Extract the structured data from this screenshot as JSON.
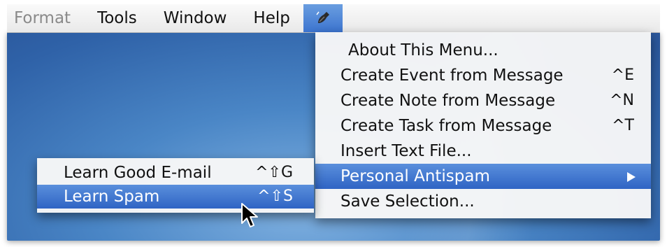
{
  "menubar": {
    "items": [
      "Format",
      "Tools",
      "Window",
      "Help"
    ],
    "script_icon": "script-menu-icon"
  },
  "main_menu": {
    "items": [
      {
        "label": "About This Menu...",
        "shortcut": ""
      },
      {
        "label": "Create Event from Message",
        "shortcut": "^E"
      },
      {
        "label": "Create Note from Message",
        "shortcut": "^N"
      },
      {
        "label": "Create Task from Message",
        "shortcut": "^T"
      },
      {
        "label": "Insert Text File...",
        "shortcut": ""
      },
      {
        "label": "Personal Antispam",
        "shortcut": ""
      },
      {
        "label": "Save Selection...",
        "shortcut": ""
      }
    ]
  },
  "sub_menu": {
    "items": [
      {
        "label": "Learn Good E-mail",
        "shortcut": "^⇧G"
      },
      {
        "label": "Learn Spam",
        "shortcut": "^⇧S"
      }
    ]
  },
  "colors": {
    "highlight": "#3c74cf",
    "desktop": "#4a86c6"
  }
}
